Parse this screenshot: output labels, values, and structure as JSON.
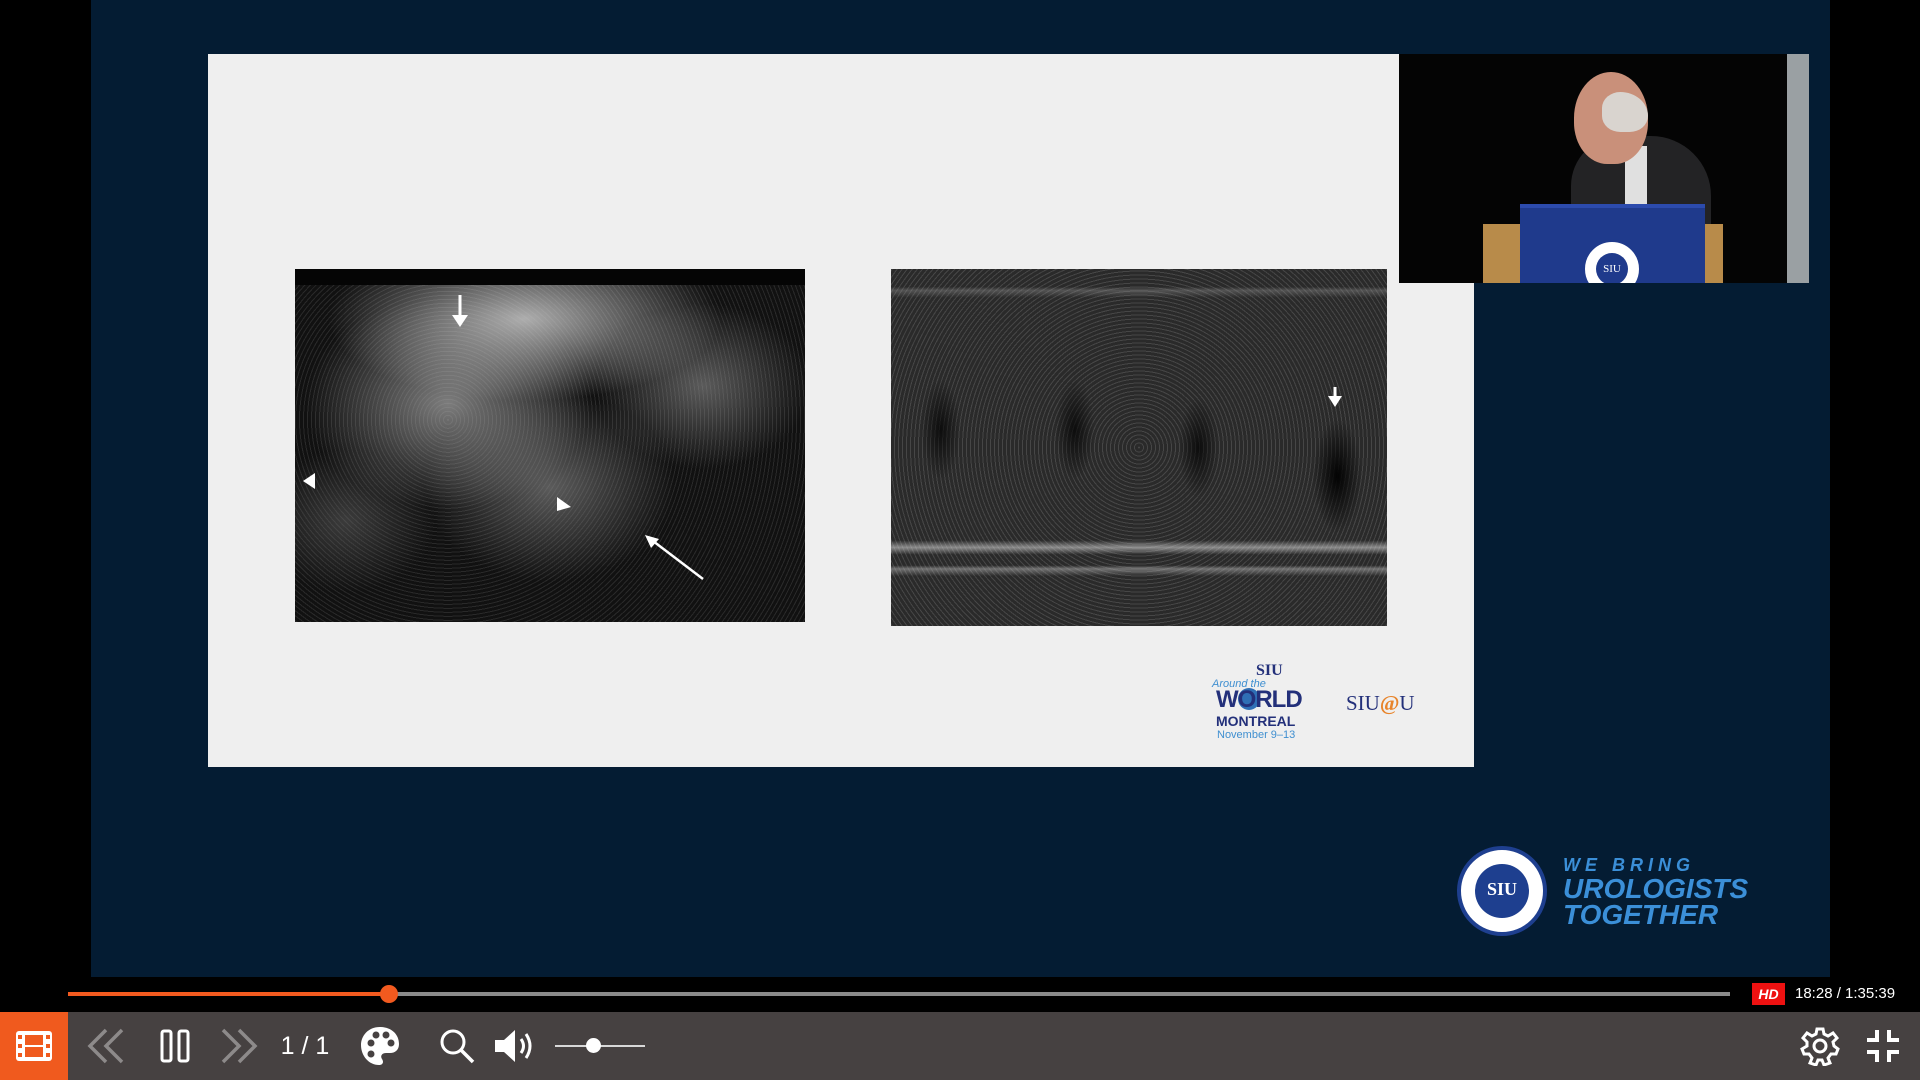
{
  "player": {
    "hd_badge": "HD",
    "time": "18:28 / 1:35:39",
    "progress_fraction": 0.193,
    "volume_fraction": 0.42
  },
  "controls": {
    "slide_counter": "1 / 1",
    "icons": [
      "film-strip-icon",
      "previous-icon",
      "pause-icon",
      "next-icon",
      "palette-icon",
      "search-icon",
      "volume-icon",
      "gear-icon",
      "exit-fullscreen-icon"
    ]
  },
  "slide": {
    "conference_logo": {
      "org": "SIU",
      "tagline": "Around the",
      "world": "WORLD",
      "city": "MONTREAL",
      "dates": "November 9–13"
    },
    "siu_at_u": {
      "prefix": "SIU",
      "at": "@",
      "suffix": "U"
    }
  },
  "speaker_video": {
    "podium_seal": "SIU"
  },
  "branding": {
    "seal_text": "SIU",
    "line1": "WE BRING",
    "line2": "UROLOGISTS",
    "line3": "TOGETHER"
  },
  "colors": {
    "accent": "#f05a1e",
    "background": "#041c33",
    "control_bar": "#464141",
    "brand_blue": "#3b8fd8"
  }
}
